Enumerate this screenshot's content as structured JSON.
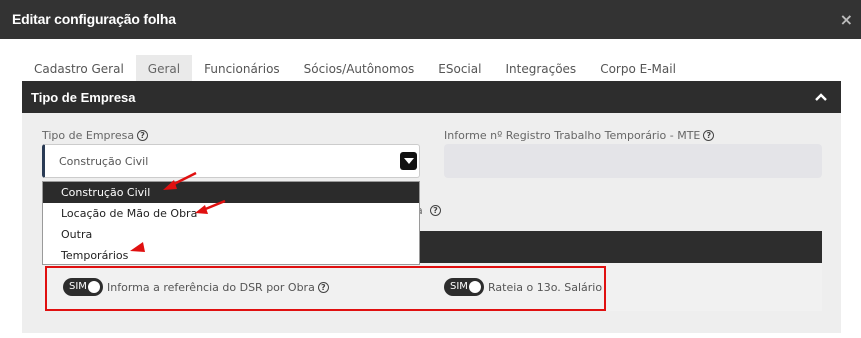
{
  "window": {
    "title": "Editar configuração folha",
    "close_glyph": "×"
  },
  "tabs": [
    {
      "label": "Cadastro Geral"
    },
    {
      "label": "Geral",
      "active": true
    },
    {
      "label": "Funcionários"
    },
    {
      "label": "Sócios/Autônomos"
    },
    {
      "label": "ESocial"
    },
    {
      "label": "Integrações"
    },
    {
      "label": "Corpo E-Mail"
    }
  ],
  "section": {
    "title": "Tipo de Empresa",
    "collapse_icon": "chevron-up-icon"
  },
  "form": {
    "tipo_label": "Tipo de Empresa",
    "tipo_value": "Construção Civil",
    "mte_label": "Informe nº Registro Trabalho Temporário - MTE",
    "mte_value": "",
    "help_glyph": "?",
    "partial_label": "a"
  },
  "dropdown": {
    "options": [
      {
        "label": "Construção Civil",
        "selected": true
      },
      {
        "label": "Locação de Mão de Obra"
      },
      {
        "label": "Outra"
      },
      {
        "label": "Temporários"
      }
    ]
  },
  "toggles": [
    {
      "state": "SIM",
      "label": "Informa a referência do DSR por Obra",
      "has_help": true
    },
    {
      "state": "SIM",
      "label": "Rateia o 13o. Salário",
      "has_help": false
    }
  ],
  "colors": {
    "header_dark": "#333333",
    "section_dark": "#2d2d2d",
    "highlight_red": "#e01010",
    "panel_bg": "#eeeeee"
  }
}
